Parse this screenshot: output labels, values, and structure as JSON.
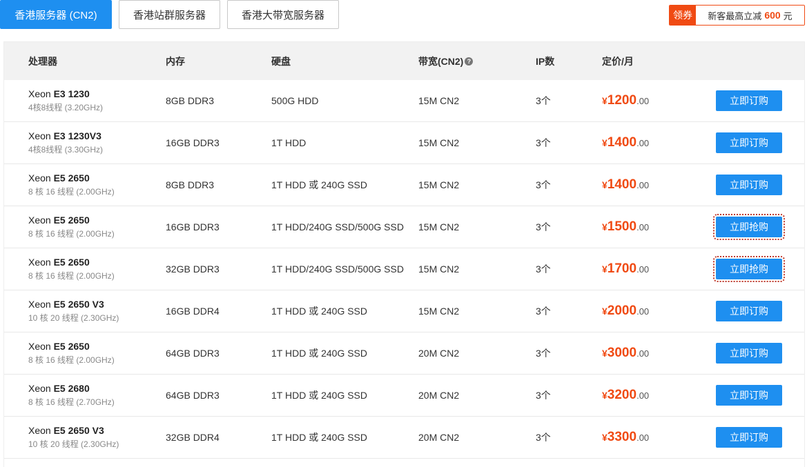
{
  "tabs": [
    {
      "label": "香港服务器 (CN2)",
      "active": true
    },
    {
      "label": "香港站群服务器",
      "active": false
    },
    {
      "label": "香港大带宽服务器",
      "active": false
    }
  ],
  "coupon": {
    "tag": "领券",
    "text": "新客最高立减",
    "amount": "600",
    "unit": "元"
  },
  "table": {
    "headers": {
      "cpu": "处理器",
      "memory": "内存",
      "disk": "硬盘",
      "bandwidth": "带宽(CN2)",
      "ip": "IP数",
      "price": "定价/月"
    },
    "currency": "¥",
    "rows": [
      {
        "cpu_brand": "Xeon",
        "cpu_model": "E3 1230",
        "cpu_spec": "4核8线程 (3.20GHz)",
        "memory": "8GB DDR3",
        "disk": "500G HDD",
        "bandwidth": "15M CN2",
        "ip": "3个",
        "price_int": "1200",
        "price_dec": ".00",
        "button": "立即订购",
        "flash": false
      },
      {
        "cpu_brand": "Xeon",
        "cpu_model": "E3 1230V3",
        "cpu_spec": "4核8线程 (3.30GHz)",
        "memory": "16GB DDR3",
        "disk": "1T HDD",
        "bandwidth": "15M CN2",
        "ip": "3个",
        "price_int": "1400",
        "price_dec": ".00",
        "button": "立即订购",
        "flash": false
      },
      {
        "cpu_brand": "Xeon",
        "cpu_model": "E5 2650",
        "cpu_spec": "8 核 16 线程 (2.00GHz)",
        "memory": "8GB DDR3",
        "disk": "1T HDD 或 240G SSD",
        "bandwidth": "15M CN2",
        "ip": "3个",
        "price_int": "1400",
        "price_dec": ".00",
        "button": "立即订购",
        "flash": false
      },
      {
        "cpu_brand": "Xeon",
        "cpu_model": "E5 2650",
        "cpu_spec": "8 核 16 线程 (2.00GHz)",
        "memory": "16GB DDR3",
        "disk": "1T HDD/240G SSD/500G SSD",
        "bandwidth": "15M CN2",
        "ip": "3个",
        "price_int": "1500",
        "price_dec": ".00",
        "button": "立即抢购",
        "flash": true
      },
      {
        "cpu_brand": "Xeon",
        "cpu_model": "E5 2650",
        "cpu_spec": "8 核 16 线程 (2.00GHz)",
        "memory": "32GB DDR3",
        "disk": "1T HDD/240G SSD/500G SSD",
        "bandwidth": "15M CN2",
        "ip": "3个",
        "price_int": "1700",
        "price_dec": ".00",
        "button": "立即抢购",
        "flash": true
      },
      {
        "cpu_brand": "Xeon",
        "cpu_model": "E5 2650 V3",
        "cpu_spec": "10 核 20 线程 (2.30GHz)",
        "memory": "16GB DDR4",
        "disk": "1T HDD 或 240G SSD",
        "bandwidth": "15M CN2",
        "ip": "3个",
        "price_int": "2000",
        "price_dec": ".00",
        "button": "立即订购",
        "flash": false
      },
      {
        "cpu_brand": "Xeon",
        "cpu_model": "E5 2650",
        "cpu_spec": "8 核 16 线程 (2.00GHz)",
        "memory": "64GB DDR3",
        "disk": "1T HDD 或 240G SSD",
        "bandwidth": "20M CN2",
        "ip": "3个",
        "price_int": "3000",
        "price_dec": ".00",
        "button": "立即订购",
        "flash": false
      },
      {
        "cpu_brand": "Xeon",
        "cpu_model": "E5 2680",
        "cpu_spec": "8 核 16 线程 (2.70GHz)",
        "memory": "64GB DDR3",
        "disk": "1T HDD 或 240G SSD",
        "bandwidth": "20M CN2",
        "ip": "3个",
        "price_int": "3200",
        "price_dec": ".00",
        "button": "立即订购",
        "flash": false
      },
      {
        "cpu_brand": "Xeon",
        "cpu_model": "E5 2650 V3",
        "cpu_spec": "10 核 20 线程 (2.30GHz)",
        "memory": "32GB DDR4",
        "disk": "1T HDD 或 240G SSD",
        "bandwidth": "20M CN2",
        "ip": "3个",
        "price_int": "3300",
        "price_dec": ".00",
        "button": "立即订购",
        "flash": false
      }
    ]
  },
  "colors": {
    "accent": "#1e8ff0",
    "price": "#f04a13",
    "header_bg": "#f2f2f2"
  },
  "icons": {
    "bandwidth_help": "question-circle-icon"
  }
}
